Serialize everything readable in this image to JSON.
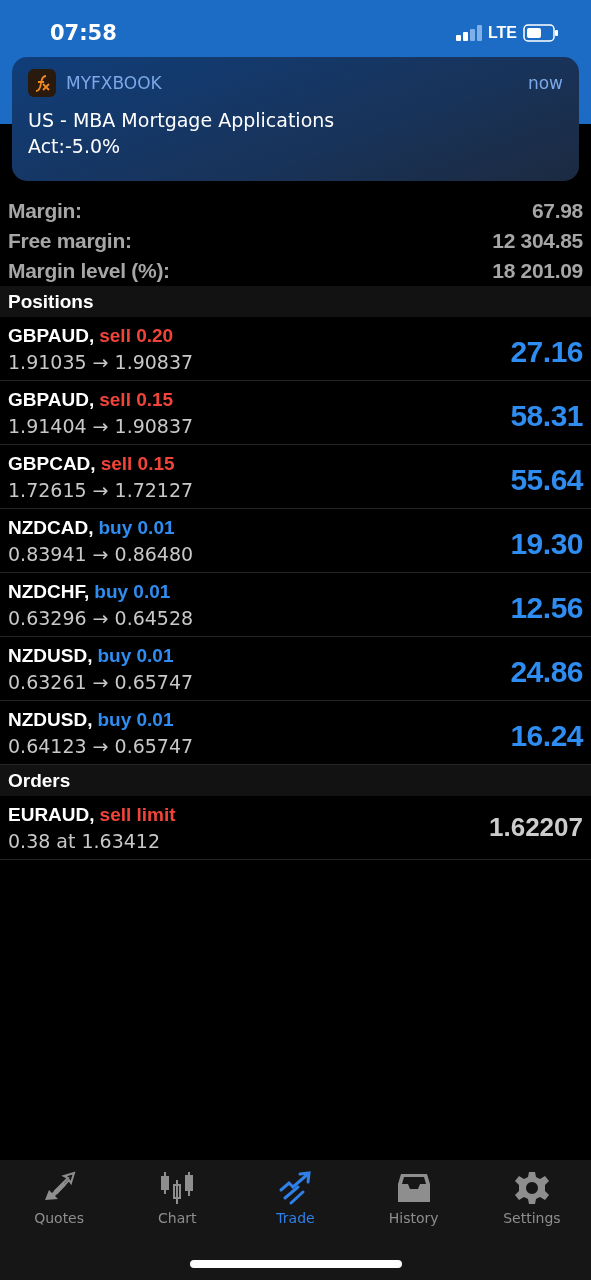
{
  "status_bar": {
    "time": "07:58",
    "network": "LTE"
  },
  "notification": {
    "app": "MYFXBOOK",
    "time": "now",
    "title": "US - MBA Mortgage Applications",
    "body": "Act:-5.0%"
  },
  "account": [
    {
      "label": "Margin:",
      "value": "67.98"
    },
    {
      "label": "Free margin:",
      "value": "12 304.85"
    },
    {
      "label": "Margin level (%):",
      "value": "18 201.09"
    }
  ],
  "positions": {
    "title": "Positions",
    "items": [
      {
        "symbol": "GBPAUD,",
        "type": "sell 0.20",
        "color": "#f0443a",
        "prices": "1.91035 → 1.90837",
        "profit": "27.16"
      },
      {
        "symbol": "GBPAUD,",
        "type": "sell 0.15",
        "color": "#f0443a",
        "prices": "1.91404 → 1.90837",
        "profit": "58.31"
      },
      {
        "symbol": "GBPCAD,",
        "type": "sell 0.15",
        "color": "#f0443a",
        "prices": "1.72615 → 1.72127",
        "profit": "55.64"
      },
      {
        "symbol": "NZDCAD,",
        "type": "buy 0.01",
        "color": "#2f8cf0",
        "prices": "0.83941 → 0.86480",
        "profit": "19.30"
      },
      {
        "symbol": "NZDCHF,",
        "type": "buy 0.01",
        "color": "#2f8cf0",
        "prices": "0.63296 → 0.64528",
        "profit": "12.56"
      },
      {
        "symbol": "NZDUSD,",
        "type": "buy 0.01",
        "color": "#2f8cf0",
        "prices": "0.63261 → 0.65747",
        "profit": "24.86"
      },
      {
        "symbol": "NZDUSD,",
        "type": "buy 0.01",
        "color": "#2f8cf0",
        "prices": "0.64123 → 0.65747",
        "profit": "16.24"
      }
    ]
  },
  "orders": {
    "title": "Orders",
    "items": [
      {
        "symbol": "EURAUD,",
        "type": "sell limit",
        "color": "#f0443a",
        "details": "0.38 at 1.63412",
        "price": "1.62207"
      }
    ]
  },
  "tabs": [
    {
      "label": "Quotes",
      "selected": false
    },
    {
      "label": "Chart",
      "selected": false
    },
    {
      "label": "Trade",
      "selected": true
    },
    {
      "label": "History",
      "selected": false
    },
    {
      "label": "Settings",
      "selected": false
    }
  ]
}
